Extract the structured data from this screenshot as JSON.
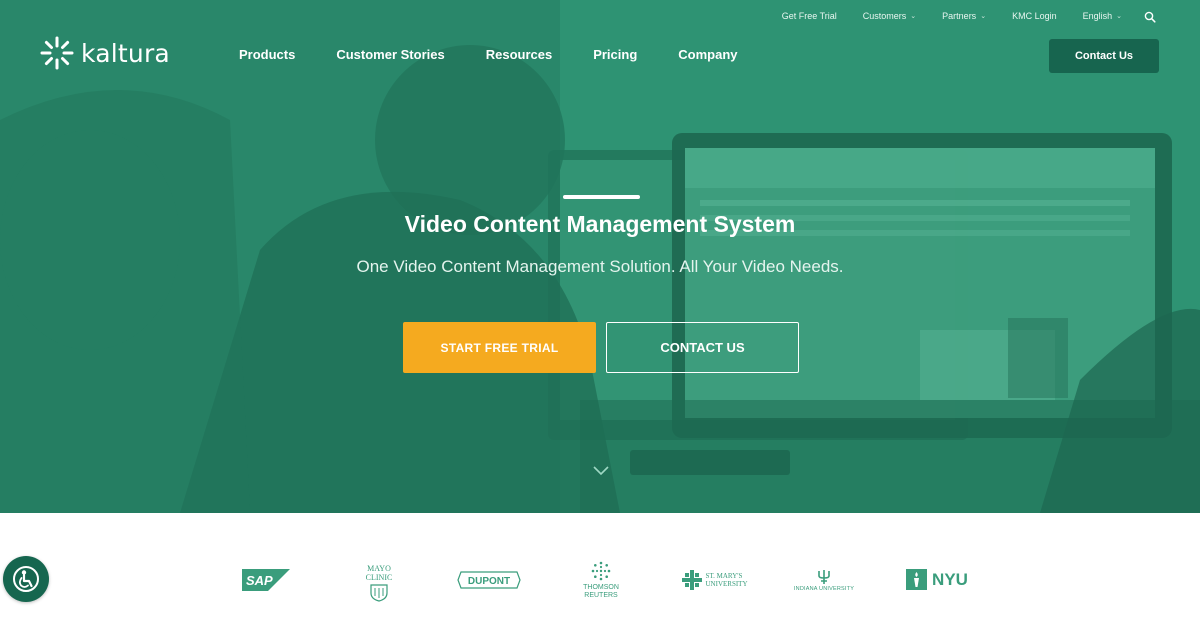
{
  "brand": {
    "name": "kaltura",
    "color_primary": "#2f9474",
    "color_dark": "#17654f",
    "color_accent": "#f5aa1f"
  },
  "utility_nav": {
    "items": [
      {
        "label": "Get Free Trial"
      },
      {
        "label": "Customers",
        "dropdown": true
      },
      {
        "label": "Partners",
        "dropdown": true
      },
      {
        "label": "KMC Login"
      },
      {
        "label": "English",
        "dropdown": true
      }
    ],
    "search_icon": "search-icon"
  },
  "main_nav": {
    "items": [
      "Products",
      "Customer Stories",
      "Resources",
      "Pricing",
      "Company"
    ],
    "contact_label": "Contact Us"
  },
  "hero": {
    "title": "Video Content Management System",
    "subtitle": "One Video Content Management Solution. All Your Video Needs.",
    "primary_cta": "START FREE TRIAL",
    "secondary_cta": "CONTACT US",
    "scroll_icon": "chevron-down-icon"
  },
  "clients": [
    {
      "name": "SAP",
      "line1": "SAP"
    },
    {
      "name": "Mayo Clinic",
      "line1": "MAYO",
      "line2": "CLINIC"
    },
    {
      "name": "DuPont",
      "line1": "DUPONT"
    },
    {
      "name": "Thomson Reuters",
      "line1": "THOMSON",
      "line2": "REUTERS"
    },
    {
      "name": "St. Mary's University",
      "line1": "ST. MARY'S",
      "line2": "UNIVERSITY"
    },
    {
      "name": "Indiana University",
      "line1": "INDIANA UNIVERSITY"
    },
    {
      "name": "NYU",
      "line1": "NYU"
    }
  ],
  "accessibility": {
    "icon": "accessibility-icon"
  }
}
